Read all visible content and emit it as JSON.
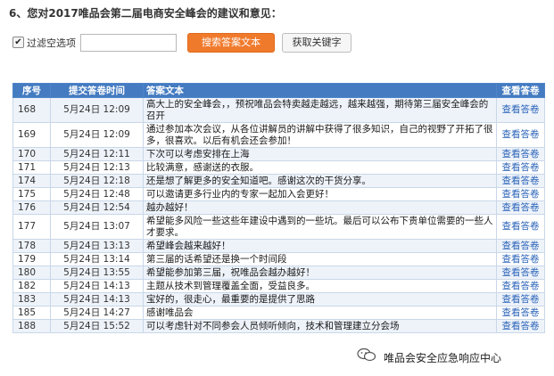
{
  "question": "6、您对2017唯品会第二届电商安全峰会的建议和意见：",
  "toolbar": {
    "filter_checked": true,
    "filter_label": "过滤空选项",
    "search_value": "",
    "search_button": "搜索答案文本",
    "keyword_button": "获取关键字"
  },
  "table": {
    "headers": [
      "序号",
      "提交答卷时间",
      "答案文本",
      "查看答卷"
    ],
    "rows": [
      {
        "id": "168",
        "time": "5月24日 12:09",
        "answer": "高大上的安全峰会，，预祝唯品会特卖越走越远，越来越强，期待第三届安全峰会的召开",
        "view": "查看答卷"
      },
      {
        "id": "169",
        "time": "5月24日 12:09",
        "answer": "通过参加本次会议，从各位讲解员的讲解中获得了很多知识，自己的视野了开拓了很多，很喜欢。以后有机会还会参加！",
        "view": "查看答卷"
      },
      {
        "id": "170",
        "time": "5月24日 12:11",
        "answer": "下次可以考虑安排在上海",
        "view": "查看答卷"
      },
      {
        "id": "171",
        "time": "5月24日 12:13",
        "answer": "比较满意，感谢送的衣服。",
        "view": "查看答卷"
      },
      {
        "id": "174",
        "time": "5月24日 12:18",
        "answer": "还是想了解更多的安全知道吧。感谢这次的干货分享。",
        "view": "查看答卷"
      },
      {
        "id": "175",
        "time": "5月24日 12:48",
        "answer": "可以邀请更多行业内的专家一起加入会更好！",
        "view": "查看答卷"
      },
      {
        "id": "176",
        "time": "5月24日 12:54",
        "answer": "越办越好！",
        "view": "查看答卷"
      },
      {
        "id": "177",
        "time": "5月24日 13:07",
        "answer": "希望能多风险一些这些年建设中遇到的一些坑。最后可以公布下贵单位需要的一些人才要求。",
        "view": "查看答卷"
      },
      {
        "id": "178",
        "time": "5月24日 13:13",
        "answer": "希望峰会越来越好！",
        "view": "查看答卷"
      },
      {
        "id": "179",
        "time": "5月24日 13:14",
        "answer": "第三届的话希望还是换一个时间段",
        "view": "查看答卷"
      },
      {
        "id": "180",
        "time": "5月24日 13:55",
        "answer": "希望能参加第三届，祝唯品会越办越好！",
        "view": "查看答卷"
      },
      {
        "id": "182",
        "time": "5月24日 14:13",
        "answer": "主题从技术到管理覆盖全面，受益良多。",
        "view": "查看答卷"
      },
      {
        "id": "183",
        "time": "5月24日 14:13",
        "answer": "宝好的，很走心，最重要的是提供了思路",
        "view": "查看答卷"
      },
      {
        "id": "185",
        "time": "5月24日 14:27",
        "answer": "感谢唯品会",
        "view": "查看答卷"
      },
      {
        "id": "188",
        "time": "5月24日 15:52",
        "answer": "可以考虑针对不同参会人员倾听倾向，技术和管理建立分会场",
        "view": "查看答卷"
      }
    ]
  },
  "watermark": "唯品会安全应急响应中心",
  "colors": {
    "header_bg": "#447bc1",
    "search_button_bg": "#f07a2c",
    "link": "#2a63b8",
    "row_alt": "#eef3fa"
  }
}
